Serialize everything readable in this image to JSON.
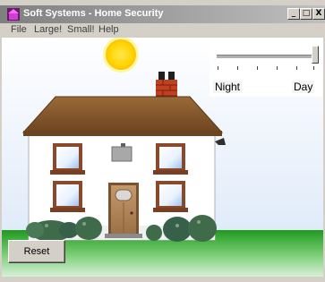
{
  "window": {
    "title": "Soft Systems - Home Security",
    "controls": {
      "minimize": "_",
      "maximize": "□",
      "close": "X"
    }
  },
  "menu": [
    "File",
    "Large!",
    "Small!",
    "Help"
  ],
  "slider": {
    "min_label": "Night",
    "max_label": "Day",
    "value_fraction": 1.0,
    "ticks": 6
  },
  "reset_button": {
    "label": "Reset"
  },
  "colors": {
    "sun": "#ffd200",
    "roof": "#8a5a2a",
    "wall": "#ffffff",
    "grass": "#2fa62a",
    "door": "#b0855a",
    "window_frame": "#8a4a2a",
    "bush": "#3f6b4a",
    "chimney": "#c04020"
  }
}
